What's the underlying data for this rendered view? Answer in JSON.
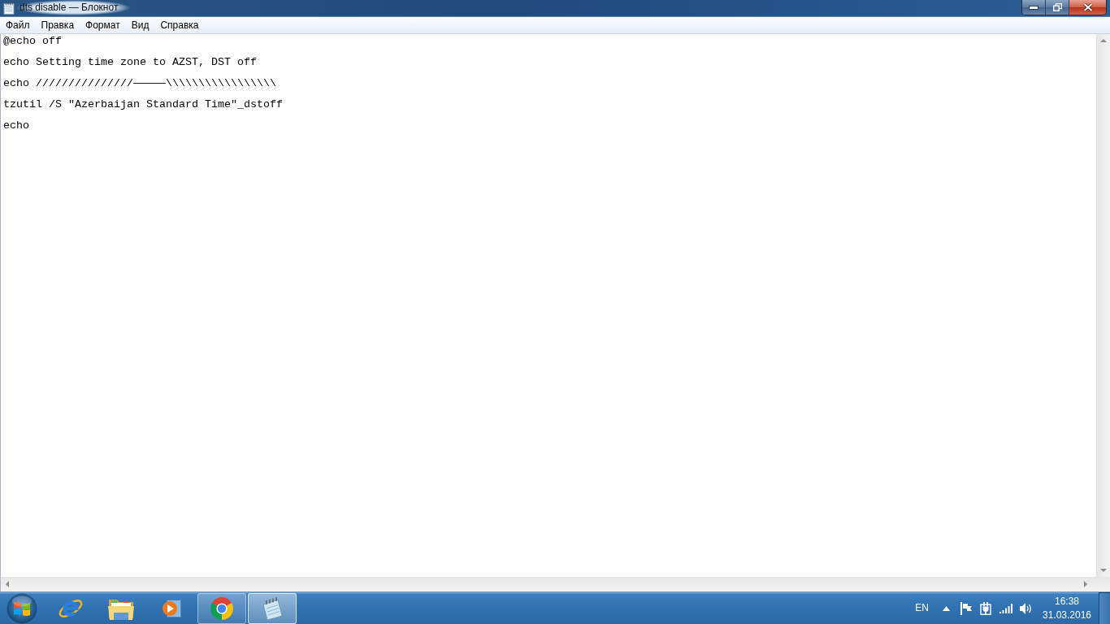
{
  "window": {
    "title": "dts disable — Блокнот"
  },
  "menu_bar": [
    "Файл",
    "Правка",
    "Формат",
    "Вид",
    "Справка"
  ],
  "editor": {
    "lines": [
      "@echo off",
      "echo Setting time zone to AZST, DST off",
      "echo ///////////////—————\\\\\\\\\\\\\\\\\\\\\\\\\\\\\\\\\\",
      "tzutil /S \"Azerbaijan Standard Time\"_dstoff",
      "echo"
    ]
  },
  "taskbar": {
    "apps": [
      {
        "kind": "e-globe",
        "running": false,
        "active": false
      },
      {
        "kind": "folder",
        "running": false,
        "active": false
      },
      {
        "kind": "player",
        "running": false,
        "active": false
      },
      {
        "kind": "ring",
        "running": true,
        "active": false
      },
      {
        "kind": "notepad",
        "running": true,
        "active": true
      }
    ],
    "language": "EN",
    "clock": {
      "time": "16:38",
      "date": "31.03.2016"
    }
  }
}
